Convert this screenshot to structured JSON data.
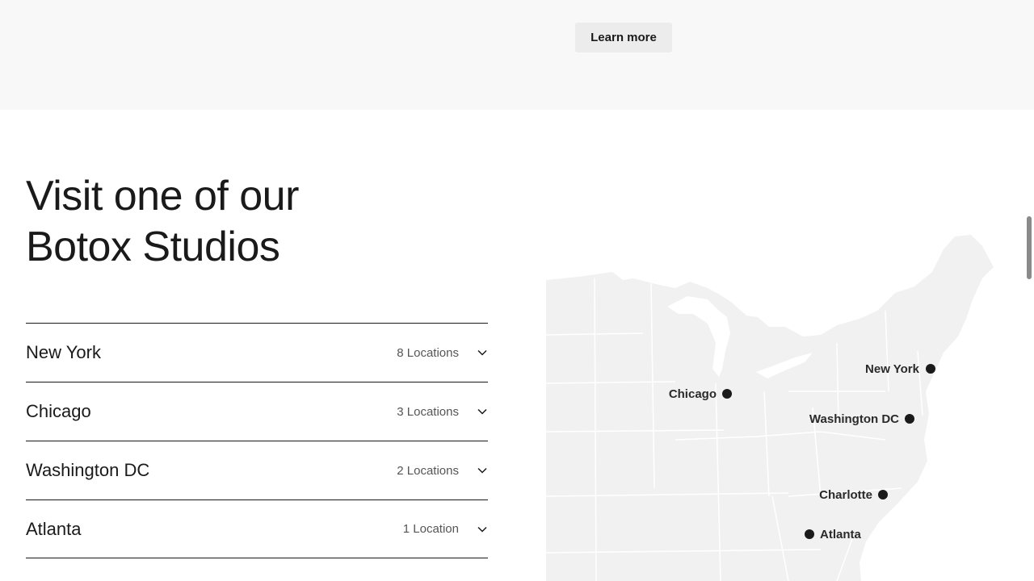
{
  "promo": {
    "learn_more_label": "Learn more"
  },
  "studios": {
    "heading_line1": "Visit one of our",
    "heading_line2": "Botox Studios",
    "cities": [
      {
        "name": "New York",
        "count": "8 Locations"
      },
      {
        "name": "Chicago",
        "count": "3 Locations"
      },
      {
        "name": "Washington DC",
        "count": "2 Locations"
      },
      {
        "name": "Atlanta",
        "count": "1 Location"
      }
    ]
  },
  "map": {
    "labels": {
      "new_york": "New York",
      "chicago": "Chicago",
      "washington": "Washington DC",
      "charlotte": "Charlotte",
      "atlanta": "Atlanta"
    }
  },
  "colors": {
    "band": "#f8f8f8",
    "button": "#ececec",
    "text": "#1a1a1a",
    "map_land": "#f1f1f1",
    "marker": "#1a1a1a"
  },
  "icons": {
    "accordion_toggle": "chevron-down-icon",
    "map_marker": "dot-marker-icon"
  }
}
